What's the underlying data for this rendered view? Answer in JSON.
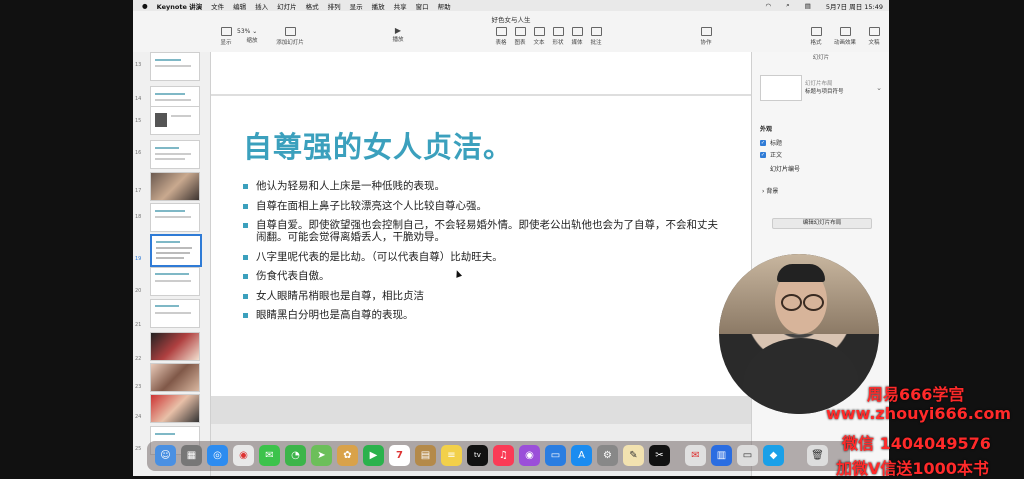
{
  "menubar": {
    "app": "Keynote 讲演",
    "items": [
      "文件",
      "编辑",
      "插入",
      "幻灯片",
      "格式",
      "排列",
      "显示",
      "播放",
      "共享",
      "窗口",
      "帮助"
    ],
    "datetime": "5月7日 周日 15:49"
  },
  "toolbar": {
    "doc_title": "好色女与人生",
    "zoom": "53%",
    "left_buttons": [
      "显示",
      "缩放",
      "添加幻灯片"
    ],
    "play_label": "播放",
    "insert_buttons": [
      "表格",
      "图表",
      "文本",
      "形状",
      "媒体",
      "批注"
    ],
    "collab_label": "协作",
    "right_buttons": [
      "格式",
      "动画效果",
      "文稿"
    ]
  },
  "slide_numbers": [
    "13",
    "14",
    "15",
    "16",
    "17",
    "18",
    "19",
    "20",
    "21",
    "22",
    "23",
    "24",
    "25"
  ],
  "slide": {
    "title": "自尊强的女人贞洁。",
    "bullets": [
      "他认为轻易和人上床是一种低贱的表现。",
      "自尊在面相上鼻子比较漂亮这个人比较自尊心强。",
      "自尊自爱。即使欲望强也会控制自己，不会轻易婚外情。即使老公出轨他也会为了自尊，不会和丈夫闹翻。可能会觉得离婚丢人，干脆劝导。",
      "八字里呢代表的是比劫。（可以代表自尊）比劫旺夫。",
      "伤食代表自傲。",
      "女人眼睛吊梢眼也是自尊，相比贞洁",
      "眼睛黑白分明也是高自尊的表现。"
    ]
  },
  "inspector": {
    "tab": "幻灯片",
    "layout_label_1": "幻灯片布局",
    "layout_label_2": "标题与项目符号",
    "appearance": "外观",
    "check_title": "标题",
    "check_body": "正文",
    "slide_number": "幻灯片编号",
    "background": "背景",
    "edit_layout": "编辑幻灯片布局"
  },
  "watermark": {
    "line1": "周易666学宫",
    "line2": "www.zhouyi666.com",
    "line3": "微信 1404049576",
    "line4": "加微V信送1000本书"
  },
  "dock": {
    "calendar_day": "7",
    "tv_label": "tv"
  },
  "colors": {
    "title": "#3ba0bd",
    "bullet": "#3ba0bd",
    "watermark": "#ff2a2a",
    "selection": "#2f7bd6"
  }
}
